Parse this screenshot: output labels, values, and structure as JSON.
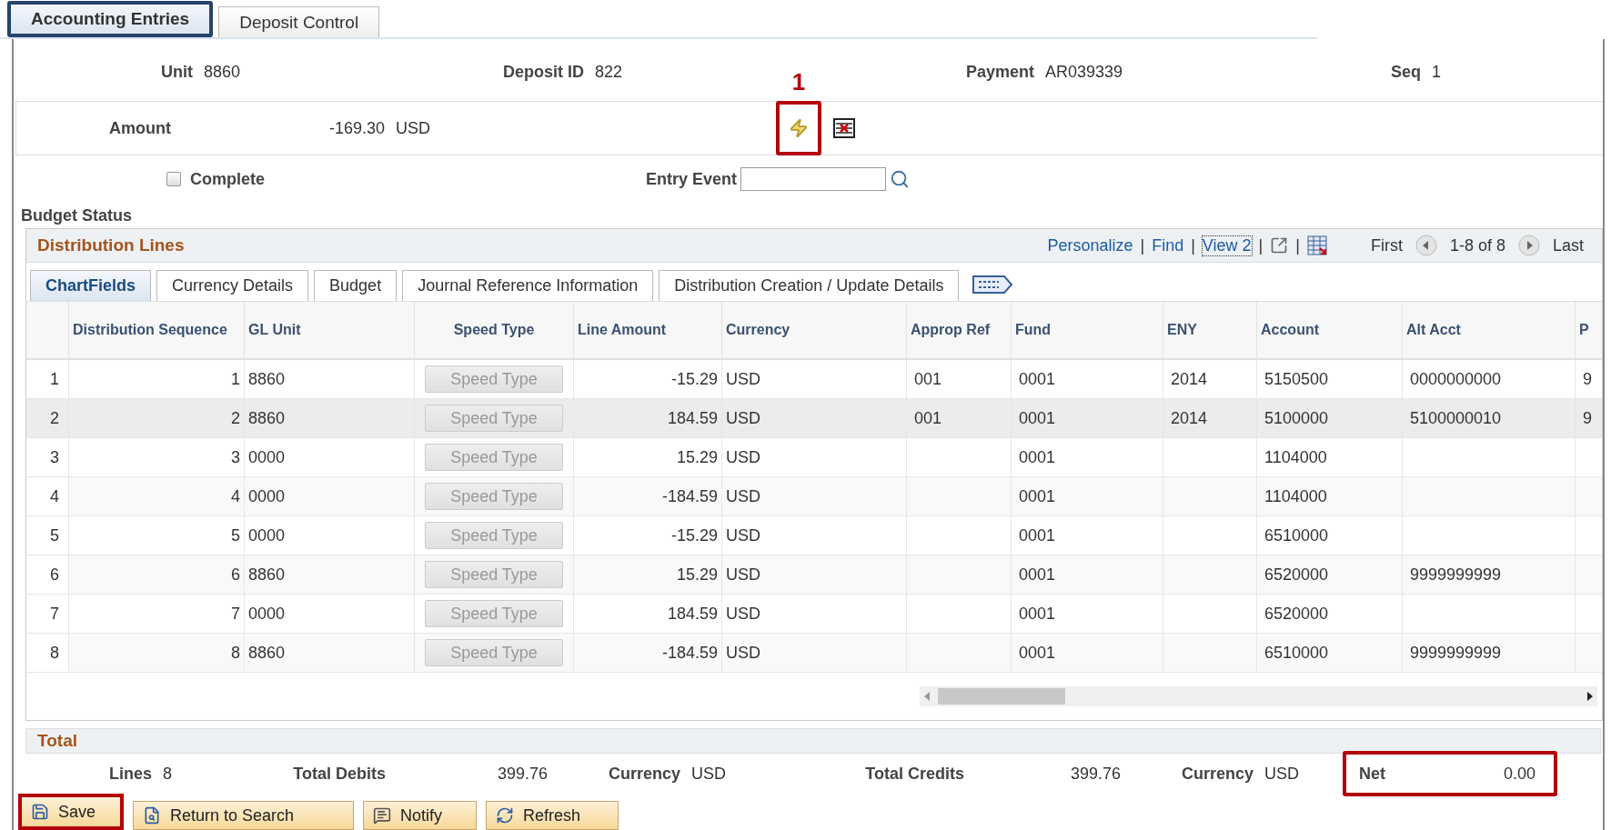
{
  "tabs": [
    {
      "label": "Accounting Entries",
      "selected": true,
      "highlighted": true
    },
    {
      "label": "Deposit Control",
      "selected": false,
      "highlighted": false
    }
  ],
  "header": [
    {
      "label": "Unit",
      "value": "8860"
    },
    {
      "label": "Deposit ID",
      "value": "822"
    },
    {
      "label": "Payment",
      "value": "AR039339"
    },
    {
      "label": "Seq",
      "value": "1"
    }
  ],
  "amount": {
    "label": "Amount",
    "value": "-169.30",
    "currency": "USD"
  },
  "amount_actions": [
    {
      "kind": "budget_check",
      "highlighted": true,
      "callout": "1"
    },
    {
      "kind": "delete",
      "highlighted": false
    }
  ],
  "complete": {
    "label": "Complete",
    "checked": false
  },
  "entry_event": {
    "label": "Entry Event"
  },
  "budget_status": {
    "label": "Budget Status"
  },
  "grid": {
    "title": "Distribution Lines",
    "links": [
      "Personalize",
      "Find",
      "View 2"
    ],
    "separator": "|",
    "first": "First",
    "range": "1-8 of 8",
    "last": "Last",
    "tabs": [
      {
        "label": "ChartFields",
        "selected": true
      },
      {
        "label": "Currency Details",
        "selected": false
      },
      {
        "label": "Budget",
        "selected": false
      },
      {
        "label": "Journal Reference Information",
        "selected": false
      },
      {
        "label": "Distribution Creation / Update Details",
        "selected": false
      }
    ],
    "columns": [
      {
        "label": "Distribution Sequence",
        "kind": "number"
      },
      {
        "label": "GL Unit",
        "kind": "text"
      },
      {
        "label": "Speed Type",
        "kind": "button",
        "disabled": true
      },
      {
        "label": "Line Amount",
        "kind": "amount"
      },
      {
        "label": "Currency",
        "kind": "text"
      },
      {
        "label": "Approp Ref",
        "kind": "text"
      },
      {
        "label": "Fund",
        "kind": "text"
      },
      {
        "label": "ENY",
        "kind": "text"
      },
      {
        "label": "Account",
        "kind": "text"
      },
      {
        "label": "Alt Acct",
        "kind": "text"
      },
      {
        "label": "P",
        "kind": "text"
      }
    ],
    "rows": [
      {
        "number": "1",
        "selected": false,
        "cells": [
          "1",
          "8860",
          "Speed Type",
          "-15.29",
          "USD",
          "001",
          "0001",
          "2014",
          "5150500",
          "0000000000",
          "9"
        ]
      },
      {
        "number": "2",
        "selected": true,
        "cells": [
          "2",
          "8860",
          "Speed Type",
          "184.59",
          "USD",
          "001",
          "0001",
          "2014",
          "5100000",
          "5100000010",
          "9"
        ]
      },
      {
        "number": "3",
        "selected": false,
        "cells": [
          "3",
          "0000",
          "Speed Type",
          "15.29",
          "USD",
          null,
          "0001",
          null,
          "1104000",
          null,
          null
        ]
      },
      {
        "number": "4",
        "selected": false,
        "cells": [
          "4",
          "0000",
          "Speed Type",
          "-184.59",
          "USD",
          null,
          "0001",
          null,
          "1104000",
          null,
          null
        ]
      },
      {
        "number": "5",
        "selected": false,
        "cells": [
          "5",
          "0000",
          "Speed Type",
          "-15.29",
          "USD",
          null,
          "0001",
          null,
          "6510000",
          null,
          null
        ]
      },
      {
        "number": "6",
        "selected": false,
        "cells": [
          "6",
          "8860",
          "Speed Type",
          "15.29",
          "USD",
          null,
          "0001",
          null,
          "6520000",
          "9999999999",
          null
        ]
      },
      {
        "number": "7",
        "selected": false,
        "cells": [
          "7",
          "0000",
          "Speed Type",
          "184.59",
          "USD",
          null,
          "0001",
          null,
          "6520000",
          null,
          null
        ]
      },
      {
        "number": "8",
        "selected": false,
        "cells": [
          "8",
          "8860",
          "Speed Type",
          "-184.59",
          "USD",
          null,
          "0001",
          null,
          "6510000",
          "9999999999",
          null
        ]
      }
    ]
  },
  "totals": {
    "title": "Total",
    "items": [
      {
        "label": "Lines",
        "value": "8",
        "highlighted": false
      },
      {
        "label": "Total Debits",
        "value": "399.76",
        "highlighted": false
      },
      {
        "label": "Currency",
        "value": "USD",
        "highlighted": false
      },
      {
        "label": "Total Credits",
        "value": "399.76",
        "highlighted": false
      },
      {
        "label": "Currency",
        "value": "USD",
        "highlighted": false
      },
      {
        "label": "Net",
        "value": "0.00",
        "highlighted": true
      }
    ]
  },
  "buttons": [
    {
      "label": "Save",
      "kind": "save",
      "highlighted": true
    },
    {
      "label": "Return to Search",
      "kind": "return",
      "highlighted": false
    },
    {
      "label": "Notify",
      "kind": "notify",
      "highlighted": false
    },
    {
      "label": "Refresh",
      "kind": "refresh",
      "highlighted": false
    }
  ]
}
